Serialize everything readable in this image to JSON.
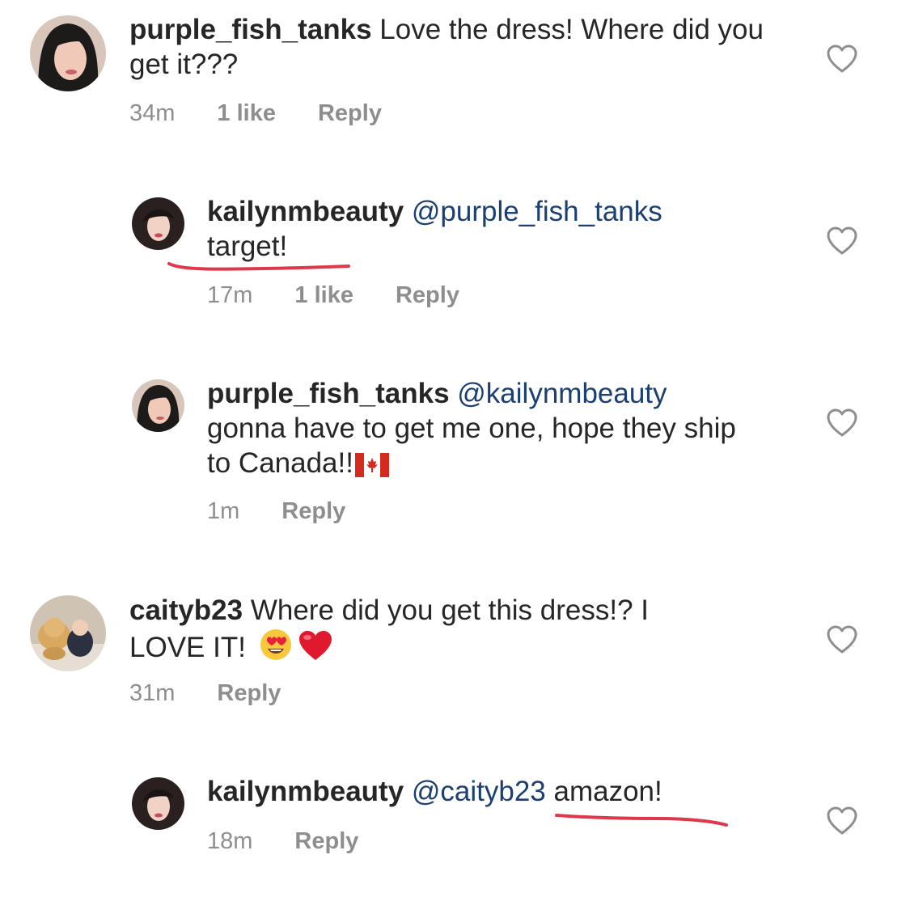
{
  "accent": {
    "mention": "#1b3f72",
    "meta": "#8e8e8e",
    "underline": "#e0384b"
  },
  "comments": [
    {
      "username": "purple_fish_tanks",
      "text": " Love the dress! Where did you get it???",
      "time": "34m",
      "likes": "1 like",
      "reply": "Reply"
    },
    {
      "username": "kailynmbeauty",
      "mention": " @purple_fish_tanks",
      "text": "target!",
      "time": "17m",
      "likes": "1 like",
      "reply": "Reply"
    },
    {
      "username": "purple_fish_tanks",
      "mention": " @kailynmbeauty",
      "text": "gonna have to get me one, hope they ship to Canada!!",
      "emoji": "canada-flag",
      "time": "1m",
      "reply": "Reply"
    },
    {
      "username": "caityb23",
      "text": " Where did you get this dress!? I LOVE IT! ",
      "emojis": [
        "heart-eyes-emoji",
        "red-heart-emoji"
      ],
      "time": "31m",
      "reply": "Reply"
    },
    {
      "username": "kailynmbeauty",
      "mention": " @caityb23",
      "text": " amazon!",
      "time": "18m",
      "reply": "Reply"
    }
  ]
}
